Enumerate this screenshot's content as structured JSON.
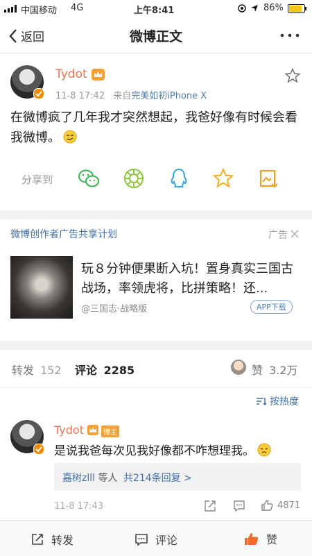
{
  "status_bar": {
    "carrier": "中国移动",
    "network": "4G",
    "time": "上午8:41",
    "battery": "86%"
  },
  "nav": {
    "back_label": "返回",
    "title": "微博正文"
  },
  "post": {
    "author": "Tydot",
    "time": "11-8 17:42",
    "source_prefix": "来自",
    "source": "完美如初iPhone X",
    "text": "在微博疯了几年我才突然想起，我爸好像有时候会看我微博。",
    "share_label": "分享到"
  },
  "ad": {
    "title": "微博创作者广告共享计划",
    "tag": "广告",
    "text": "玩８分钟便果断入坑！置身真实三国古战场，率领虎将，比拼策略！还...",
    "source": "@三国志·战略版",
    "button": "APP下载"
  },
  "tabs": {
    "repost_label": "转发",
    "repost_count": "152",
    "comment_label": "评论",
    "comment_count": "2285",
    "like_label": "赞",
    "like_count": "3.2万"
  },
  "sort_label": "按热度",
  "comment": {
    "author": "Tydot",
    "badge": "博主",
    "text": "是说我爸每次见我好像都不咋想理我。",
    "reply_users": "嘉树zlll",
    "reply_mid": "等人",
    "reply_count_text": "共214条回复 >",
    "time": "11-8 17:43",
    "like_count": "4871"
  },
  "bottom_bar": {
    "repost": "转发",
    "comment": "评论",
    "like": "赞"
  },
  "colors": {
    "orange": "#eb7350",
    "link_blue": "#507daf",
    "background": "#f2f2f2"
  }
}
